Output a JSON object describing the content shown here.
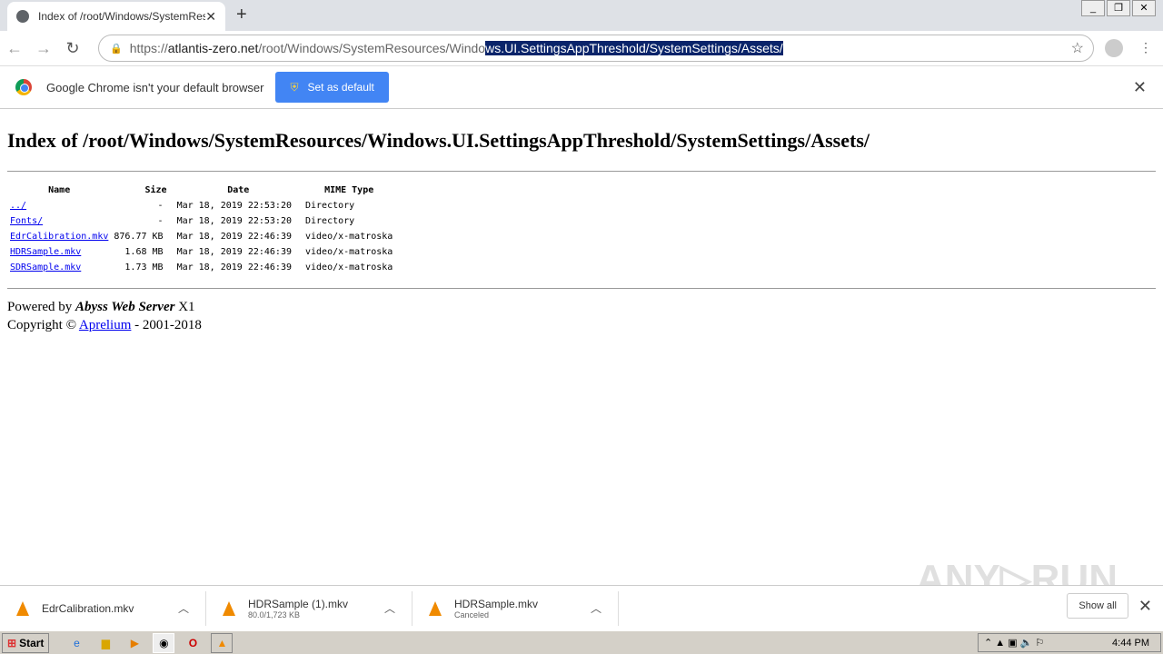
{
  "browser": {
    "tab_title": "Index of /root/Windows/SystemResources/Windows.UI.SettingsAppThreshold/SystemSettings/Assets/",
    "url_scheme": "https://",
    "url_host": "atlantis-zero.net",
    "url_path_plain": "/root/Windows/SystemResources/Windo",
    "url_path_selected": "ws.UI.SettingsAppThreshold/SystemSettings/Assets/"
  },
  "infobar": {
    "message": "Google Chrome isn't your default browser",
    "button": "Set as default"
  },
  "page": {
    "title": "Index of /root/Windows/SystemResources/Windows.UI.SettingsAppThreshold/SystemSettings/Assets/",
    "columns": [
      "Name",
      "Size",
      "Date",
      "MIME Type"
    ],
    "rows": [
      {
        "name": "../",
        "size": "-",
        "date": "Mar 18, 2019 22:53:20",
        "type": "Directory"
      },
      {
        "name": "Fonts/",
        "size": "-",
        "date": "Mar 18, 2019 22:53:20",
        "type": "Directory"
      },
      {
        "name": "EdrCalibration.mkv",
        "size": "876.77 KB",
        "date": "Mar 18, 2019 22:46:39",
        "type": "video/x-matroska"
      },
      {
        "name": "HDRSample.mkv",
        "size": "1.68 MB",
        "date": "Mar 18, 2019 22:46:39",
        "type": "video/x-matroska"
      },
      {
        "name": "SDRSample.mkv",
        "size": "1.73 MB",
        "date": "Mar 18, 2019 22:46:39",
        "type": "video/x-matroska"
      }
    ],
    "powered_prefix": "Powered by ",
    "server": "Abyss Web Server",
    "server_suffix": " X1",
    "copyright_prefix": "Copyright © ",
    "company": "Aprelium",
    "copyright_suffix": " - 2001-2018"
  },
  "downloads": [
    {
      "name": "EdrCalibration.mkv",
      "status": ""
    },
    {
      "name": "HDRSample (1).mkv",
      "status": "80.0/1,723 KB"
    },
    {
      "name": "HDRSample.mkv",
      "status": "Canceled"
    }
  ],
  "show_all": "Show all",
  "watermark": "ANY RUN",
  "taskbar": {
    "start": "Start",
    "clock": "4:44 PM"
  }
}
